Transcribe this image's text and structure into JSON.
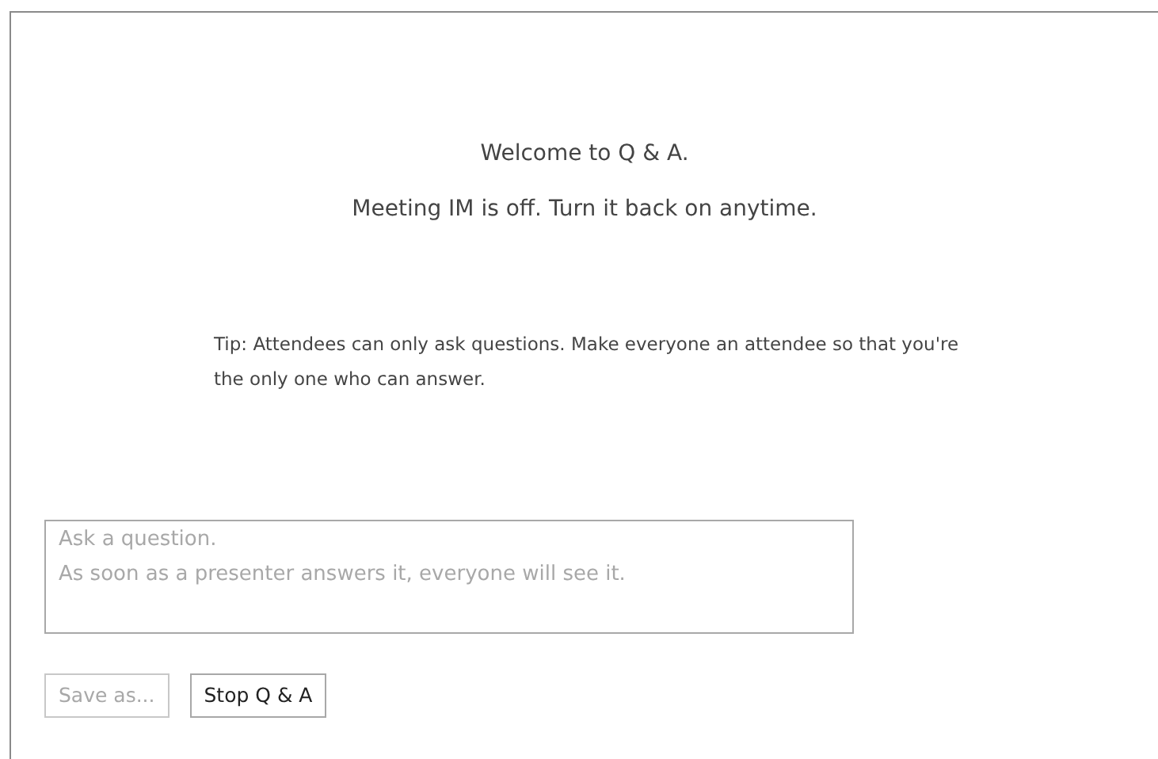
{
  "welcome": "Welcome to Q & A.",
  "im_status": "Meeting IM is off. Turn it back on anytime.",
  "tip": "Tip: Attendees can only ask questions. Make everyone an attendee so that you're the only one who can answer.",
  "question_field": {
    "placeholder": "Ask a question.\nAs soon as a presenter answers it, everyone will see it."
  },
  "buttons": [
    {
      "label": "Save as...",
      "disabled": true
    },
    {
      "label": "Stop Q & A",
      "disabled": false
    }
  ]
}
